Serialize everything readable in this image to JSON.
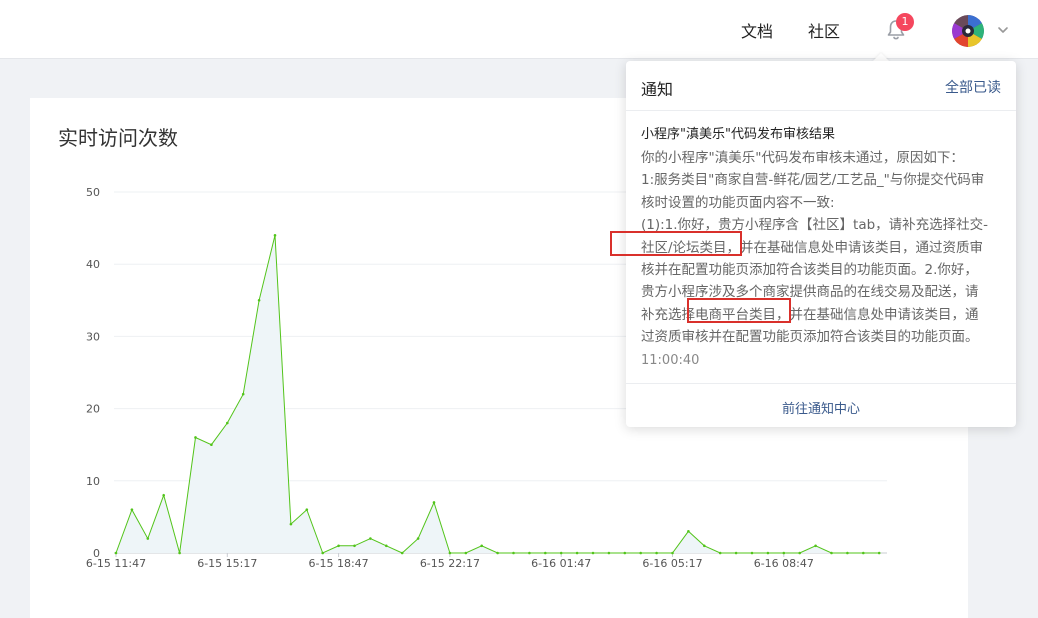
{
  "header": {
    "docs_label": "文档",
    "community_label": "社区",
    "notification_count": "1",
    "icons": {
      "bell": "bell-icon",
      "avatar": "avatar",
      "dropdown": "chevron-down-icon"
    },
    "colors": {
      "badge": "#f5475e"
    }
  },
  "card": {
    "title": "实时访问次数"
  },
  "notifications": {
    "title": "通知",
    "mark_all_read": "全部已读",
    "item": {
      "title": "小程序\"滇美乐\"代码发布审核结果",
      "lines": [
        "你的小程序\"滇美乐\"代码发布审核未通过，原因如下：",
        "1:服务类目\"商家自营-鲜花/园艺/工艺品_\"与你提交代码审",
        "核时设置的功能页面内容不一致:",
        "(1):1.你好，贵方小程序含【社区】tab，请补充选择社交-",
        "社区/论坛类目，并在基础信息处申请该类目，通过资质审",
        "核并在配置功能页添加符合该类目的功能页面。2.你好，",
        "贵方小程序涉及多个商家提供商品的在线交易及配送，请",
        "补充选择电商平台类目，并在基础信息处申请该类目，通",
        "过资质审核并在配置功能页添加符合该类目的功能页面。"
      ],
      "time": "11:00:40"
    },
    "footer_link": "前往通知中心"
  },
  "chart_data": {
    "type": "area",
    "title": "实时访问次数",
    "ylim": [
      0,
      50
    ],
    "yticks": [
      0,
      10,
      20,
      30,
      40,
      50
    ],
    "x_tick_labels": [
      "6-15 11:47",
      "6-15 15:17",
      "6-15 18:47",
      "6-15 22:17",
      "6-16 01:47",
      "6-16 05:17",
      "6-16 08:47"
    ],
    "x_tick_indices": [
      0,
      7,
      14,
      21,
      28,
      35,
      42
    ],
    "grid": true,
    "color": "#52c41a",
    "fill": "#eef5f8",
    "values": [
      0,
      6,
      2,
      8,
      0,
      16,
      15,
      18,
      22,
      35,
      44,
      4,
      6,
      0,
      1,
      1,
      2,
      1,
      0,
      2,
      7,
      0,
      0,
      1,
      0,
      0,
      0,
      0,
      0,
      0,
      0,
      0,
      0,
      0,
      0,
      0,
      3,
      1,
      0,
      0,
      0,
      0,
      0,
      0,
      1,
      0,
      0,
      0,
      0
    ]
  }
}
